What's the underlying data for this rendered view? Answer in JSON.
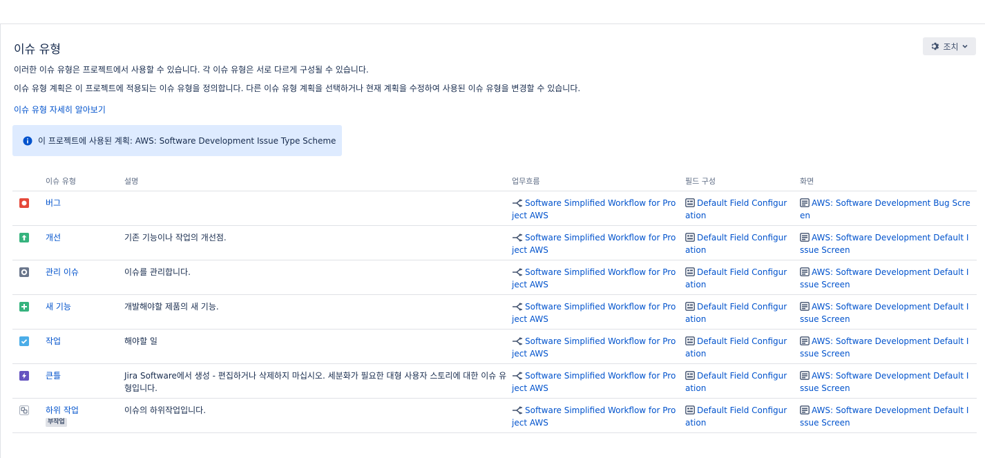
{
  "page": {
    "title": "이슈 유형",
    "actions_label": "조치",
    "desc1": "이러한 이슈 유형은 프로젝트에서 사용할 수 있습니다. 각 이슈 유형은 서로 다르게 구성될 수 있습니다.",
    "desc2": "이슈 유형 계획은 이 프로젝트에 적용되는 이슈 유형을 정의합니다. 다른 이슈 유형 계획을 선택하거나 현재 계획을 수정하여 사용된 이슈 유형을 변경할 수 있습니다.",
    "learn_more": "이슈 유형 자세히 알아보기",
    "info_text": "이 프로젝트에 사용된 계획: AWS: Software Development Issue Type Scheme"
  },
  "table": {
    "headers": {
      "type": "이슈 유형",
      "desc": "설명",
      "workflow": "업무흐름",
      "field": "필드 구성",
      "screen": "화면"
    },
    "rows": [
      {
        "name": "버그",
        "desc": "",
        "workflow": "Software Simplified Workflow for Project AWS",
        "field": "Default Field Configuration",
        "screen": "AWS: Software Development Bug Screen",
        "icon": "bug-icon",
        "color": "#e5493a"
      },
      {
        "name": "개선",
        "desc": "기존 기능이나 작업의 개선점.",
        "workflow": "Software Simplified Workflow for Project AWS",
        "field": "Default Field Configuration",
        "screen": "AWS: Software Development Default Issue Screen",
        "icon": "improvement-icon",
        "color": "#36b37e"
      },
      {
        "name": "관리 이슈",
        "desc": "이슈를 관리합니다.",
        "workflow": "Software Simplified Workflow for Project AWS",
        "field": "Default Field Configuration",
        "screen": "AWS: Software Development Default Issue Screen",
        "icon": "management-icon",
        "color": "#6b778c"
      },
      {
        "name": "새 기능",
        "desc": "개발해야할 제품의 새 기능.",
        "workflow": "Software Simplified Workflow for Project AWS",
        "field": "Default Field Configuration",
        "screen": "AWS: Software Development Default Issue Screen",
        "icon": "new-feature-icon",
        "color": "#36b37e"
      },
      {
        "name": "작업",
        "desc": "해야할 일",
        "workflow": "Software Simplified Workflow for Project AWS",
        "field": "Default Field Configuration",
        "screen": "AWS: Software Development Default Issue Screen",
        "icon": "task-icon",
        "color": "#4bade8"
      },
      {
        "name": "큰틀",
        "desc": "Jira Software에서 생성 - 편집하거나 삭제하지 마십시오. 세분화가 필요한 대형 사용자 스토리에 대한 이슈 유형입니다.",
        "workflow": "Software Simplified Workflow for Project AWS",
        "field": "Default Field Configuration",
        "screen": "AWS: Software Development Default Issue Screen",
        "icon": "epic-icon",
        "color": "#6554c0"
      },
      {
        "name": "하위 작업",
        "desc": "이슈의 하위작업입니다.",
        "workflow": "Software Simplified Workflow for Project AWS",
        "field": "Default Field Configuration",
        "screen": "AWS: Software Development Default Issue Screen",
        "icon": "subtask-icon",
        "color": "#a5adba",
        "badge": "부작업"
      }
    ]
  }
}
